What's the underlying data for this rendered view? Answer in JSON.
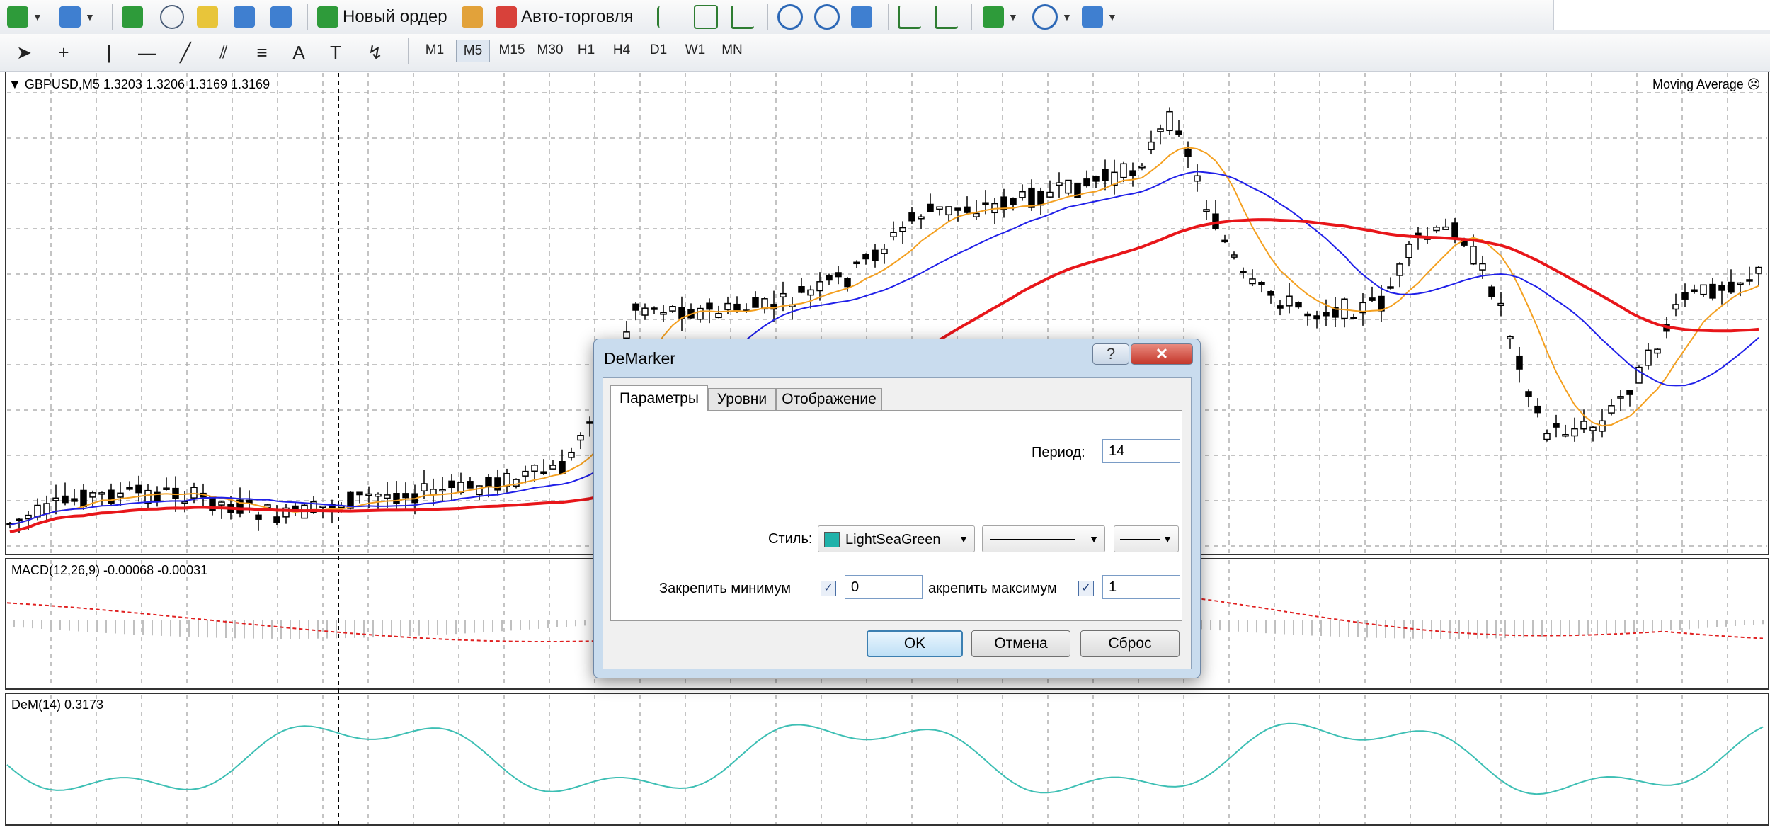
{
  "toolbar": {
    "new_order_label": "Новый ордер",
    "auto_trading_label": "Авто-торговля",
    "timeframes": [
      "M1",
      "M5",
      "M15",
      "M30",
      "H1",
      "H4",
      "D1",
      "W1",
      "MN"
    ],
    "selected_timeframe": "M5"
  },
  "chart": {
    "main_label": "GBPUSD,M5  1.3203 1.3206 1.3169 1.3169",
    "indicator_label": "Moving Average",
    "macd_label": "MACD(12,26,9) -0.00068 -0.00031",
    "dem_label": "DeM(14) 0.3173",
    "colors": {
      "ma_fast": "#f4a020",
      "ma_mid": "#2020e8",
      "ma_slow": "#e8161a",
      "macd_signal": "#e02020",
      "dem_line": "#3dbfb4"
    }
  },
  "dialog": {
    "title": "DeMarker",
    "tabs": [
      "Параметры",
      "Уровни",
      "Отображение"
    ],
    "active_tab": "Параметры",
    "period_label": "Период:",
    "period_value": "14",
    "style_label": "Стиль:",
    "style_color_name": "LightSeaGreen",
    "style_color": "#20b2aa",
    "fix_min_label": "Закрепить минимум",
    "fix_min_value": "0",
    "fix_max_label": "акрепить максимум",
    "fix_max_value": "1",
    "ok_label": "OK",
    "cancel_label": "Отмена",
    "reset_label": "Сброс"
  }
}
